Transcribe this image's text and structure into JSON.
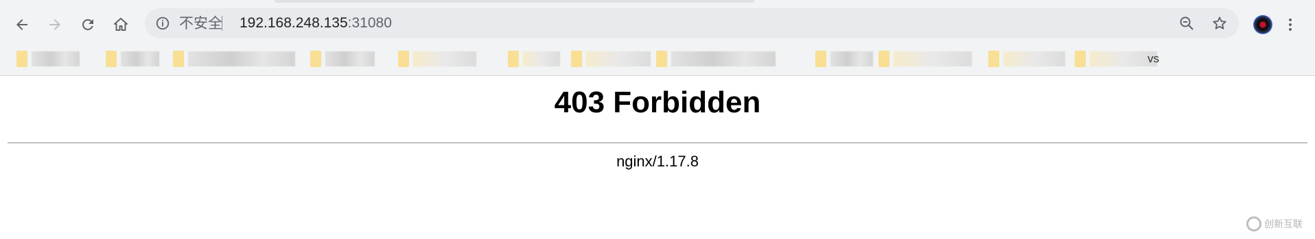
{
  "browser": {
    "nav": {
      "back_icon": "arrow-left-icon",
      "forward_icon": "arrow-right-icon",
      "reload_icon": "reload-icon",
      "home_icon": "home-icon"
    },
    "omnibox": {
      "info_icon": "info-circle-icon",
      "security_label": "不安全",
      "url_host": "192.168.248.135",
      "url_port": ":31080",
      "zoom_icon": "zoom-out-icon",
      "bookmark_icon": "star-icon"
    },
    "profile_icon": "avatar-icon",
    "menu_icon": "more-vertical-icon",
    "bookmarks_tail_text": "vs"
  },
  "page": {
    "heading": "403 Forbidden",
    "server": "nginx/1.17.8"
  },
  "watermark": {
    "text": "创新互联"
  },
  "colors": {
    "toolbar_bg": "#f1f3f4",
    "folder": "#f8df93",
    "rule": "#9a9a9a"
  }
}
